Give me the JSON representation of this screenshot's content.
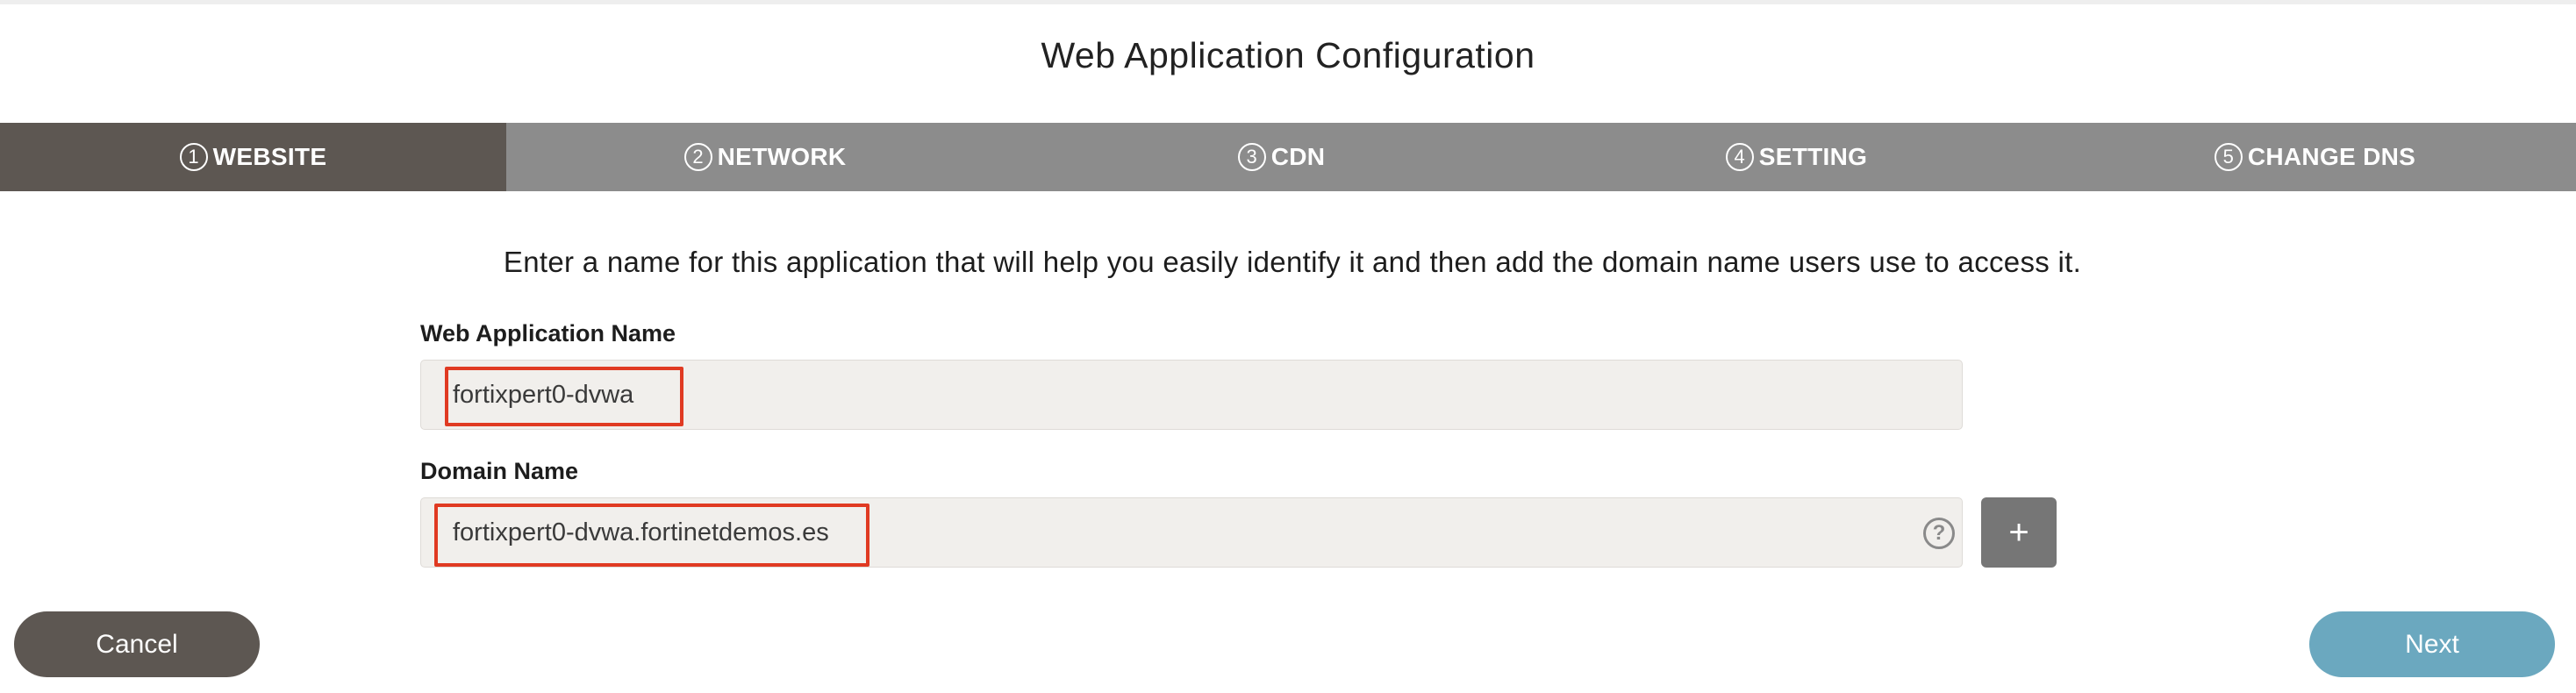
{
  "title": "Web Application Configuration",
  "steps": [
    {
      "num": "1",
      "label": "WEBSITE",
      "active": true
    },
    {
      "num": "2",
      "label": "NETWORK",
      "active": false
    },
    {
      "num": "3",
      "label": "CDN",
      "active": false
    },
    {
      "num": "4",
      "label": "SETTING",
      "active": false
    },
    {
      "num": "5",
      "label": "CHANGE DNS",
      "active": false
    }
  ],
  "intro": "Enter a name for this application that will help you easily identify it and then add the domain name users use to access it.",
  "fields": {
    "app_name": {
      "label": "Web Application Name",
      "value": "fortixpert0-dvwa"
    },
    "domain_name": {
      "label": "Domain Name",
      "value": "fortixpert0-dvwa.fortinetdemos.es"
    }
  },
  "icons": {
    "help": "question-circle-icon",
    "add": "plus-icon"
  },
  "glyphs": {
    "help": "?",
    "add": "+"
  },
  "buttons": {
    "cancel": "Cancel",
    "next": "Next"
  },
  "colors": {
    "active_step": "#5d5752",
    "step_bar": "#8c8c8c",
    "highlight": "#e03a22",
    "next_button": "#6ba8bf",
    "cancel_button": "#5d5752"
  }
}
